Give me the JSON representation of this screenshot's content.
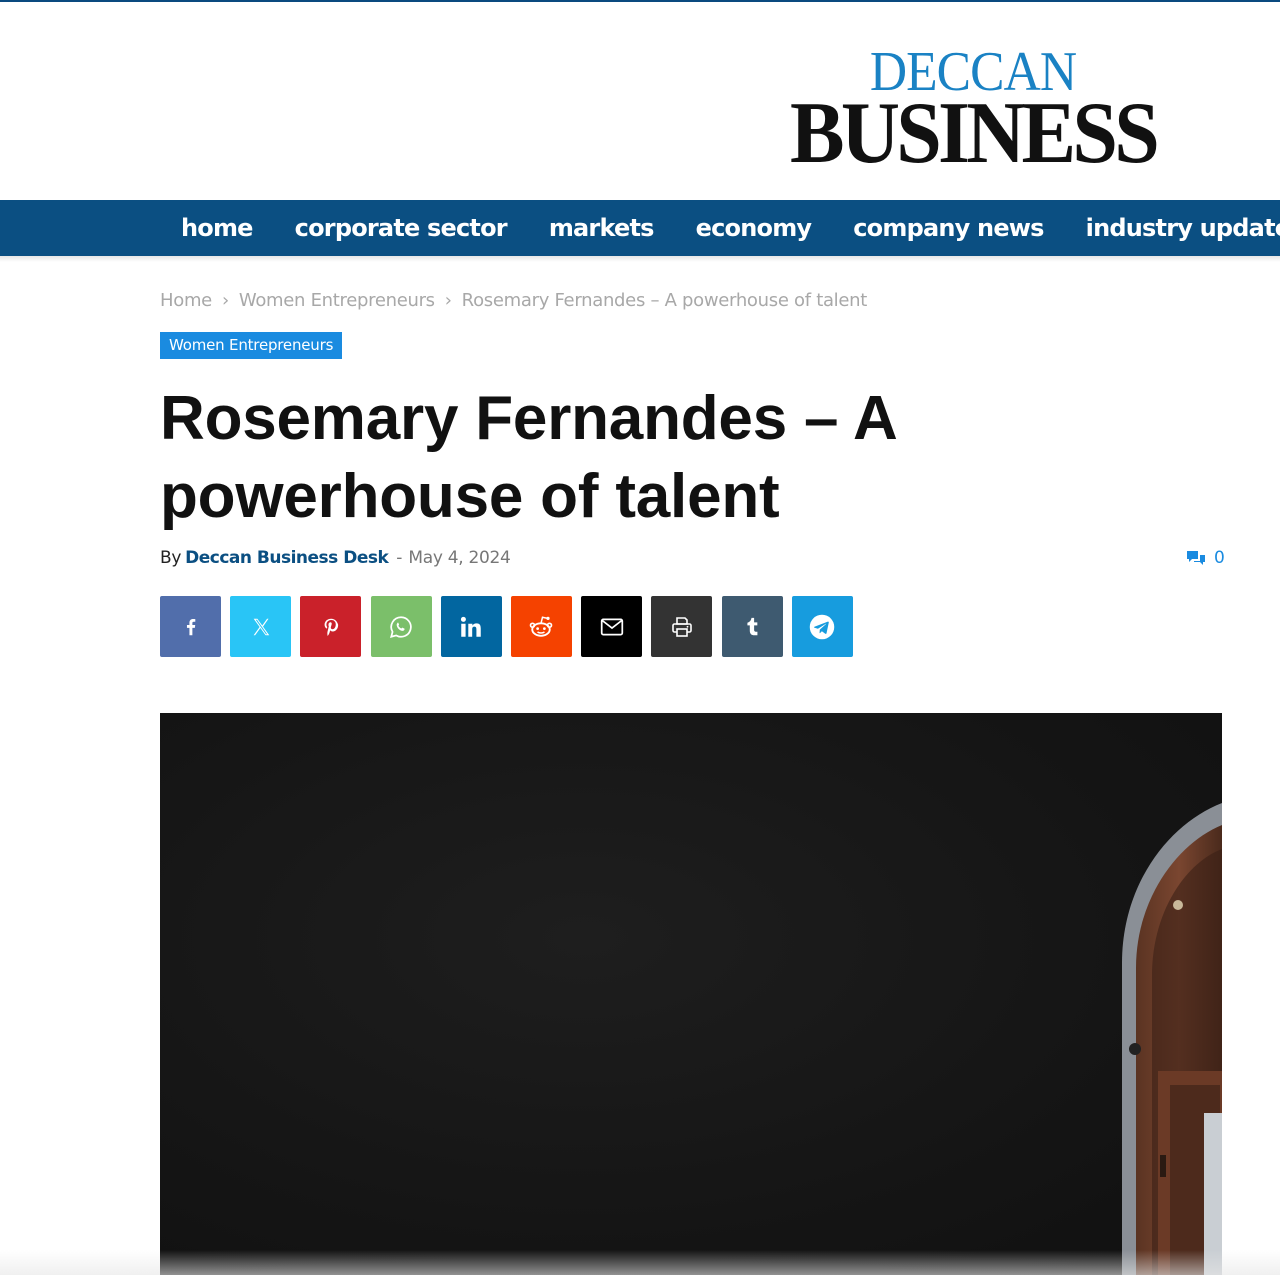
{
  "site": {
    "logo_top": "DECCAN",
    "logo_bottom": "BUSINESS",
    "brand_blue": "#1a82c4",
    "nav_color": "#0b4f82"
  },
  "nav": {
    "items": [
      {
        "label": "home"
      },
      {
        "label": "corporate sector"
      },
      {
        "label": "markets"
      },
      {
        "label": "economy"
      },
      {
        "label": "company news"
      },
      {
        "label": "industry updates",
        "icon": "chevron-down-icon"
      }
    ]
  },
  "breadcrumb": {
    "items": [
      "Home",
      "Women Entrepreneurs",
      "Rosemary Fernandes – A powerhouse of talent"
    ],
    "separator": "›"
  },
  "article": {
    "category": "Women Entrepreneurs",
    "category_color": "#1a8be0",
    "title": "Rosemary Fernandes – A powerhouse of talent",
    "by_label": "By",
    "author": "Deccan Business Desk",
    "date_separator": "-",
    "date": "May 4, 2024",
    "comment_count": "0",
    "comment_icon": "comments-icon"
  },
  "share_buttons": [
    {
      "name": "facebook",
      "icon": "facebook-icon",
      "color": "#516eab"
    },
    {
      "name": "x",
      "icon": "x-icon",
      "color": "#29c5f6"
    },
    {
      "name": "pinterest",
      "icon": "pinterest-icon",
      "color": "#ca212a"
    },
    {
      "name": "whatsapp",
      "icon": "whatsapp-icon",
      "color": "#7bbf6a"
    },
    {
      "name": "linkedin",
      "icon": "linkedin-icon",
      "color": "#0266a0"
    },
    {
      "name": "reddit",
      "icon": "reddit-icon",
      "color": "#f54200"
    },
    {
      "name": "email",
      "icon": "email-icon",
      "color": "#000000"
    },
    {
      "name": "print",
      "icon": "print-icon",
      "color": "#333333"
    },
    {
      "name": "tumblr",
      "icon": "tumblr-icon",
      "color": "#3e5a70"
    },
    {
      "name": "telegram",
      "icon": "telegram-icon",
      "color": "#179cde"
    }
  ]
}
